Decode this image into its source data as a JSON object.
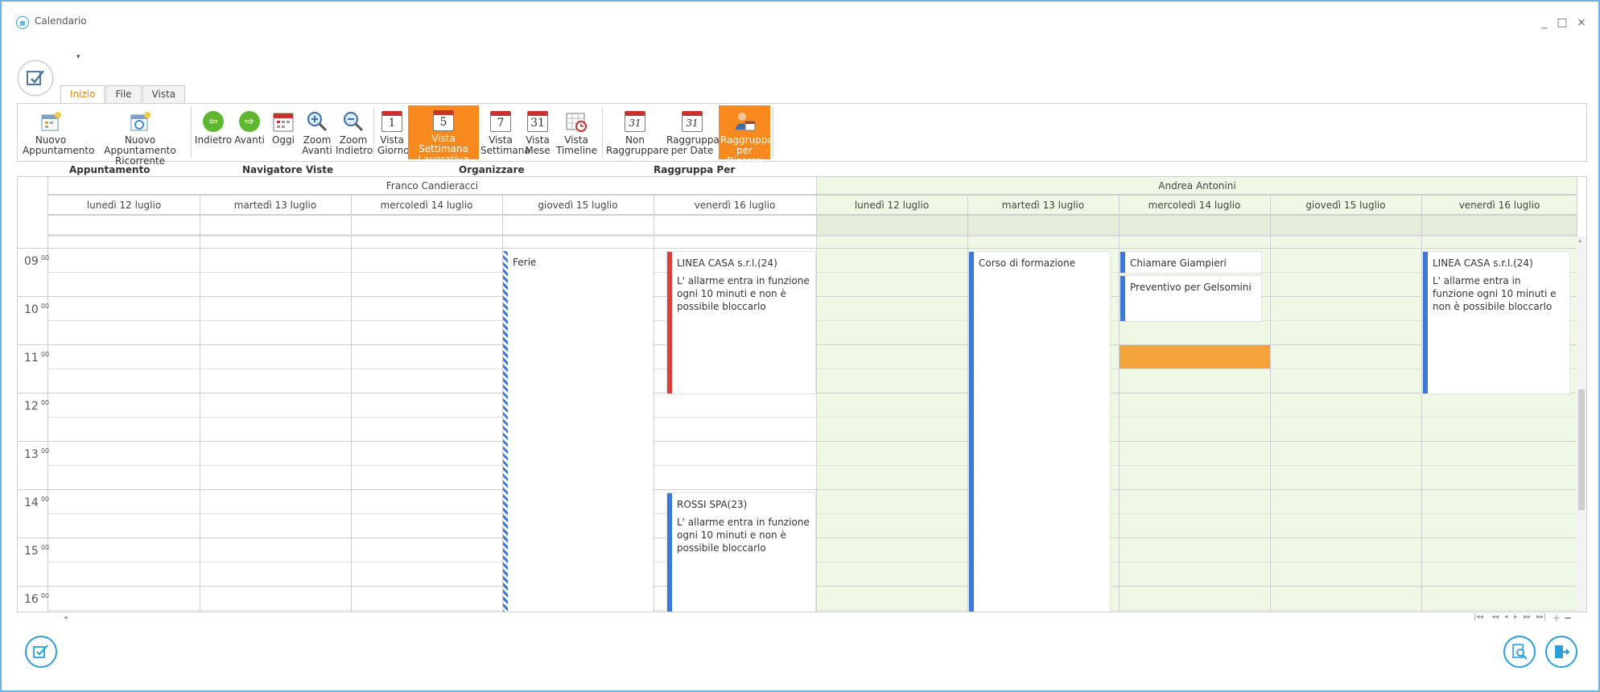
{
  "window": {
    "title": "Calendario",
    "minimize": "_",
    "maximize": "□",
    "close": "×"
  },
  "qat_glyph": "▾",
  "tabs": [
    {
      "label": "Inizio",
      "active": true
    },
    {
      "label": "File",
      "active": false
    },
    {
      "label": "Vista",
      "active": false
    }
  ],
  "ribbon": {
    "nuovo_appuntamento": "Nuovo Appuntamento",
    "nuovo_ricorrente": "Nuovo Appuntamento Ricorrente",
    "indietro": "Indietro",
    "avanti": "Avanti",
    "oggi": "Oggi",
    "zoom_avanti": "Zoom Avanti",
    "zoom_indietro": "Zoom Indietro",
    "vista_giorno": "Vista Giorno",
    "vista_giorno_num": "1",
    "vista_settimana_lav": "Vista Settimana Lavorativa",
    "vista_settimana_lav_num": "5",
    "vista_settimana": "Vista Settimana",
    "vista_settimana_num": "7",
    "vista_mese": "Vista Mese",
    "vista_mese_num": "31",
    "vista_timeline": "Vista Timeline",
    "non_raggruppare": "Non Raggruppare",
    "non_raggruppare_num": "31",
    "raggruppa_date": "Raggruppa per Date",
    "raggruppa_date_num": "31",
    "raggruppa_risorsa": "Raggruppa per Risorsa"
  },
  "groups": {
    "appuntamento": "Appuntamento",
    "navigatore": "Navigatore Viste",
    "organizzare": "Organizzare",
    "raggruppa": "Raggruppa Per"
  },
  "resources": [
    "Franco Candieracci",
    "Andrea Antonini"
  ],
  "days": [
    "lunedì 12 luglio",
    "martedì 13 luglio",
    "mercoledì 14 luglio",
    "giovedì 15 luglio",
    "venerdì 16 luglio"
  ],
  "hours": [
    "09",
    "10",
    "11",
    "12",
    "13",
    "14",
    "15",
    "16"
  ],
  "minutes": "00",
  "appointments": {
    "ferie": "Ferie",
    "linea1_title": "LINEA CASA s.r.l.(24)",
    "linea1_desc": "L' allarme entra in funzione ogni 10 minuti e non è possibile bloccarlo",
    "rossi_title": "ROSSI SPA(23)",
    "rossi_desc": "L' allarme entra in funzione ogni 10 minuti e non è possibile bloccarlo",
    "corso": "Corso di formazione",
    "chiamare": "Chiamare Giampieri",
    "preventivo": "Preventivo per Gelsomini",
    "linea2_title": "LINEA CASA s.r.l.(24)",
    "linea2_desc": "L' allarme entra in funzione ogni 10 minuti e non è possibile bloccarlo"
  },
  "colors": {
    "accent": "#f8891f",
    "red": "#d9403a",
    "blue": "#3c78d8",
    "green_bg": "#eff7e5",
    "orange_block": "#f4a23a"
  },
  "nav_glyphs": {
    "first": "|◂◂",
    "prev_page": "◂◂",
    "prev": "◂",
    "next": "▸",
    "next_page": "▸▸",
    "last": "▸▸|",
    "add": "+",
    "remove": "−",
    "scroll_left": "◂",
    "scroll_up": "▴"
  }
}
